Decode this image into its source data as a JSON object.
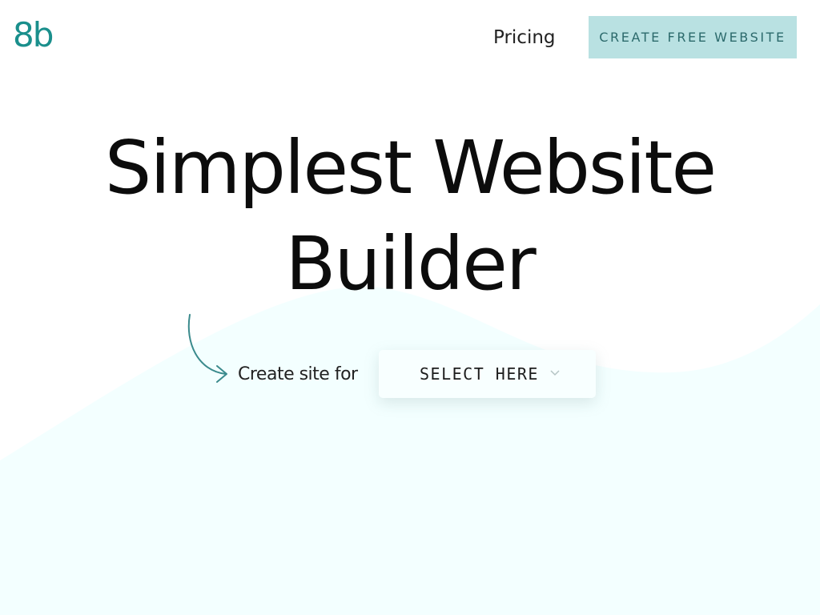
{
  "header": {
    "logo_text": "8b",
    "nav_pricing_label": "Pricing",
    "cta_label": "CREATE FREE WEBSITE"
  },
  "hero": {
    "title_line1": "Simplest Website",
    "title_line2": "Builder",
    "create_label": "Create site for",
    "select": {
      "label": "SELECT HERE",
      "icon": "chevron-down-icon"
    }
  },
  "decor": {
    "arrow_icon": "curved-arrow-icon"
  },
  "colors": {
    "brand": "#1a8f8c",
    "cta_background": "#b9e1e2",
    "cta_text": "#2c6a6c",
    "wave": "#f3ffff",
    "arrow": "#3a8a8c"
  }
}
